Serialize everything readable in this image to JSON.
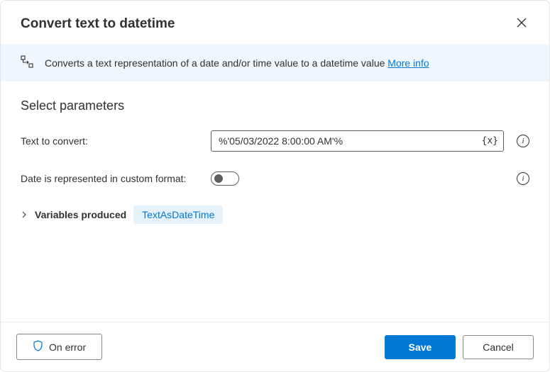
{
  "header": {
    "title": "Convert text to datetime"
  },
  "banner": {
    "text": "Converts a text representation of a date and/or time value to a datetime value ",
    "more_info": "More info"
  },
  "section": {
    "title": "Select parameters"
  },
  "fields": {
    "text_to_convert": {
      "label": "Text to convert:",
      "value": "%'05/03/2022 8:00:00 AM'%",
      "var_icon": "{x}"
    },
    "custom_format": {
      "label": "Date is represented in custom format:",
      "value": false
    }
  },
  "variables": {
    "label": "Variables produced",
    "chip": "TextAsDateTime"
  },
  "footer": {
    "on_error": "On error",
    "save": "Save",
    "cancel": "Cancel"
  }
}
